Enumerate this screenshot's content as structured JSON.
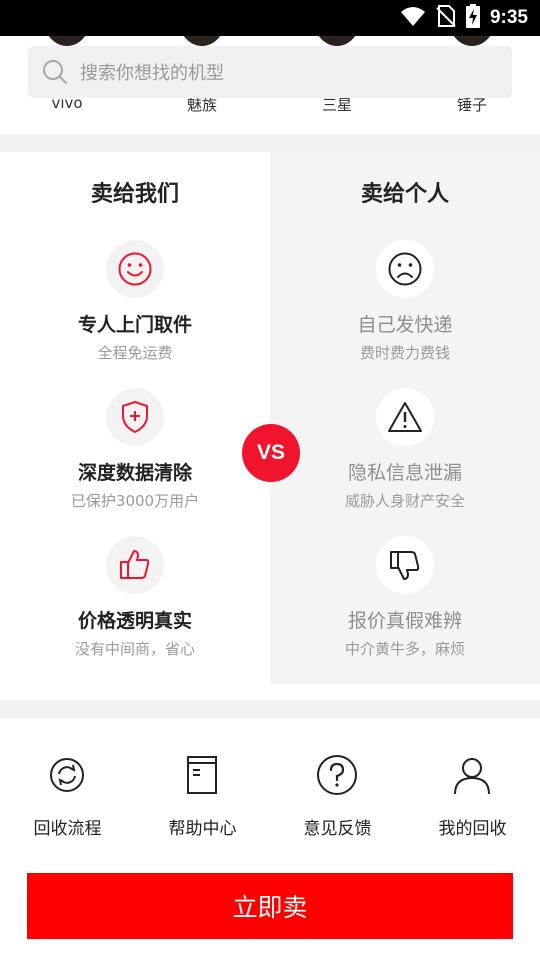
{
  "status_bar": {
    "time": "9:35"
  },
  "brands": [
    {
      "label": "vivo"
    },
    {
      "label": "魅族"
    },
    {
      "label": "三星"
    },
    {
      "label": "锤子"
    }
  ],
  "search": {
    "placeholder": "搜索你想找的机型"
  },
  "comparison": {
    "left": {
      "title": "卖给我们",
      "items": [
        {
          "icon": "smile-icon",
          "title": "专人上门取件",
          "subtitle": "全程免运费"
        },
        {
          "icon": "shield-plus-icon",
          "title": "深度数据清除",
          "subtitle": "已保护3000万用户"
        },
        {
          "icon": "thumbs-up-icon",
          "title": "价格透明真实",
          "subtitle": "没有中间商，省心"
        }
      ]
    },
    "right": {
      "title": "卖给个人",
      "items": [
        {
          "icon": "sad-face-icon",
          "title": "自己发快递",
          "subtitle": "费时费力费钱"
        },
        {
          "icon": "warning-icon",
          "title": "隐私信息泄漏",
          "subtitle": "威胁人身财产安全"
        },
        {
          "icon": "thumbs-down-icon",
          "title": "报价真假难辨",
          "subtitle": "中介黄牛多，麻烦"
        }
      ]
    },
    "vs_label": "VS"
  },
  "quick_links": [
    {
      "icon": "refresh-icon",
      "label": "回收流程"
    },
    {
      "icon": "book-icon",
      "label": "帮助中心"
    },
    {
      "icon": "question-icon",
      "label": "意见反馈"
    },
    {
      "icon": "user-icon",
      "label": "我的回收"
    }
  ],
  "sell_button": {
    "label": "立即卖"
  },
  "colors": {
    "accent": "#f0142d",
    "button": "#ff0000"
  }
}
